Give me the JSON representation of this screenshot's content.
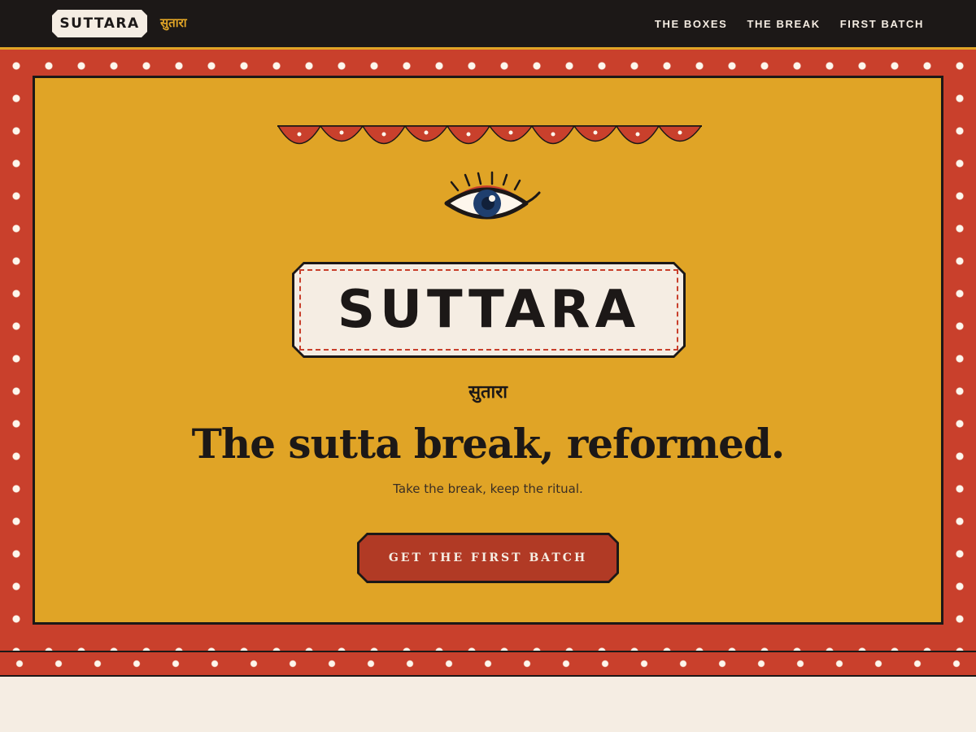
{
  "header": {
    "logo_text": "SUTTARA",
    "logo_devanagari": "सुतारा",
    "nav": [
      {
        "label": "THE BOXES"
      },
      {
        "label": "THE BREAK"
      },
      {
        "label": "FIRST BATCH"
      }
    ]
  },
  "hero": {
    "brand_name": "SUTTARA",
    "brand_devanagari": "सुतारा",
    "headline": "The sutta break, reformed.",
    "tagline": "Take the break, keep the ritual.",
    "cta_label": "GET THE FIRST BATCH"
  },
  "icons": {
    "eye": "eye-icon",
    "bunting": "bunting-garland"
  },
  "colors": {
    "dark": "#1c1817",
    "saffron": "#e0a426",
    "red": "#c9402c",
    "cream": "#f5ede3",
    "cta_red": "#b13a25",
    "iris_blue": "#1f3f6e"
  }
}
